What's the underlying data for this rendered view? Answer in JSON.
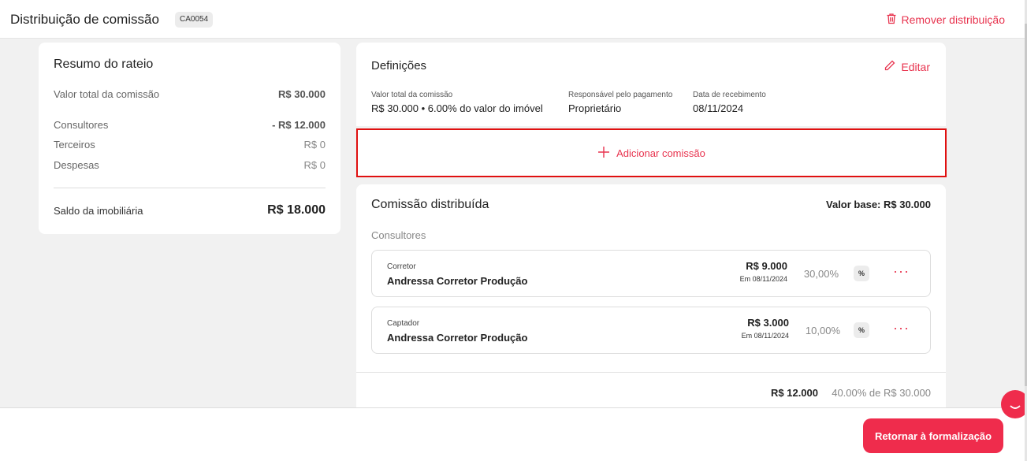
{
  "header": {
    "title": "Distribuição de comissão",
    "code": "CA0054",
    "remove_label": "Remover distribuição"
  },
  "resumo": {
    "title": "Resumo do rateio",
    "rows": [
      {
        "label": "Valor total da comissão",
        "value": "R$ 30.000"
      },
      {
        "label": "Consultores",
        "value": "- R$ 12.000"
      },
      {
        "label": "Terceiros",
        "value": "R$ 0"
      },
      {
        "label": "Despesas",
        "value": "R$ 0"
      }
    ],
    "saldo_label": "Saldo da imobiliária",
    "saldo_value": "R$ 18.000"
  },
  "definicoes": {
    "title": "Definições",
    "edit_label": "Editar",
    "fields": [
      {
        "label": "Valor total da comissão",
        "value": "R$ 30.000 • 6.00% do valor do imóvel"
      },
      {
        "label": "Responsável pelo pagamento",
        "value": "Proprietário"
      },
      {
        "label": "Data de recebimento",
        "value": "08/11/2024"
      }
    ]
  },
  "add_commission_label": "Adicionar comissão",
  "distribuida": {
    "title": "Comissão distribuída",
    "base_value": "Valor base: R$ 30.000",
    "section_label": "Consultores",
    "items": [
      {
        "role": "Corretor",
        "name": "Andressa Corretor Produção",
        "amount": "R$ 9.000",
        "date": "Em 08/11/2024",
        "percent": "30,00%",
        "percent_btn": "%"
      },
      {
        "role": "Captador",
        "name": "Andressa Corretor Produção",
        "amount": "R$ 3.000",
        "date": "Em 08/11/2024",
        "percent": "10,00%",
        "percent_btn": "%"
      }
    ],
    "total_value": "R$ 12.000",
    "total_percent": "40.00% de R$ 30.000"
  },
  "footer": {
    "return_label": "Retornar à formalização"
  },
  "colors": {
    "accent": "#ef2c4c",
    "highlight_border": "#e01010"
  }
}
